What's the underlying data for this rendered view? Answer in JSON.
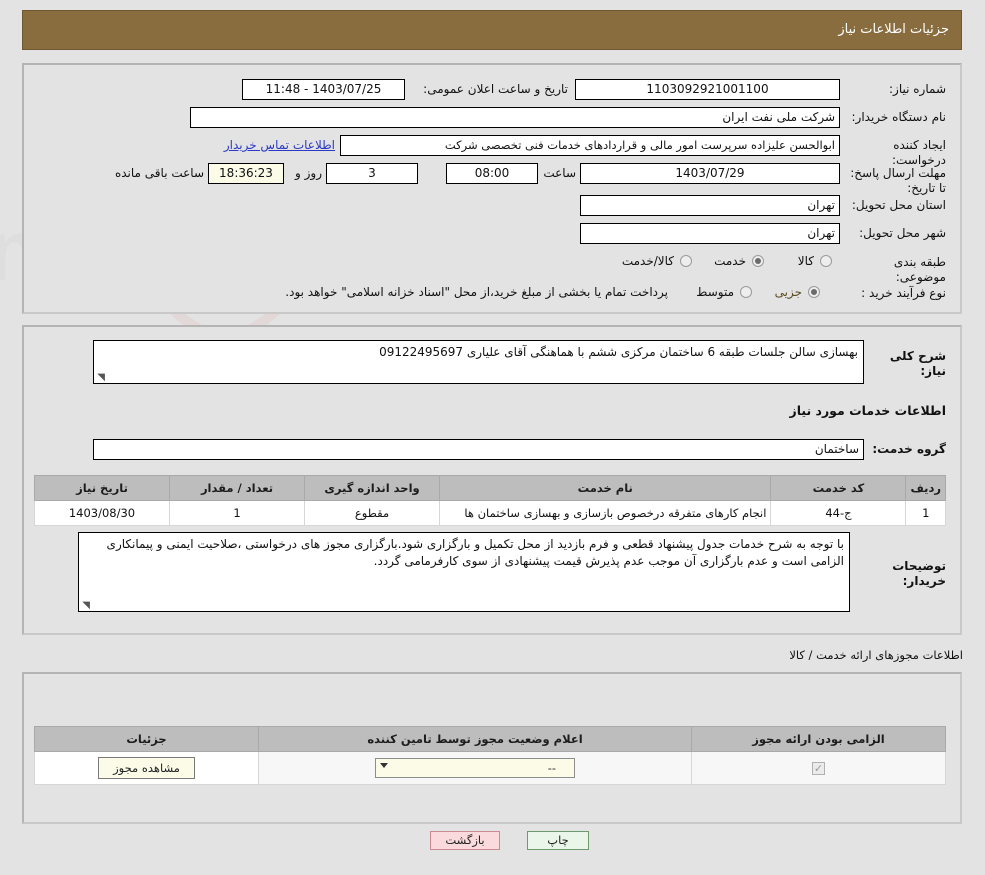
{
  "header": {
    "title": "جزئیات اطلاعات نیاز"
  },
  "form": {
    "need_number_label": "شماره نیاز:",
    "need_number_value": "1103092921001100",
    "announce_label": "تاریخ و ساعت اعلان عمومی:",
    "announce_value": "1403/07/25 - 11:48",
    "buyer_org_label": "نام دستگاه خریدار:",
    "buyer_org_value": "شرکت ملی نفت ایران",
    "requester_label": "ایجاد کننده درخواست:",
    "requester_value": "ابوالحسن علیزاده سرپرست امور مالی و قراردادهای خدمات فنی تخصصی شرکت",
    "contact_link": "اطلاعات تماس خریدار",
    "deadline_label": "مهلت ارسال پاسخ: تا تاریخ:",
    "deadline_date": "1403/07/29",
    "hour_label": "ساعت",
    "deadline_time": "08:00",
    "days_value": "3",
    "days_label": "روز و",
    "remaining_time": "18:36:23",
    "remaining_label": "ساعت باقی مانده",
    "province_label": "استان محل تحویل:",
    "province_value": "تهران",
    "city_label": "شهر محل تحویل:",
    "city_value": "تهران",
    "category_label": "طبقه بندی موضوعی:",
    "category_options": [
      "کالا",
      "خدمت",
      "کالا/خدمت"
    ],
    "category_selected": "خدمت",
    "process_label": "نوع فرآیند خرید :",
    "process_options": [
      "جزیی",
      "متوسط"
    ],
    "process_selected": "جزیی",
    "process_note": "پرداخت تمام یا بخشی از مبلغ خرید،از محل \"اسناد خزانه اسلامی\" خواهد بود."
  },
  "need": {
    "general_desc_label": "شرح کلی نیاز:",
    "general_desc_value": "بهسازی سالن جلسات طبقه 6 ساختمان مرکزی ششم با هماهنگی آقای علیاری 09122495697",
    "services_section_title": "اطلاعات خدمات مورد نیاز",
    "service_group_label": "گروه خدمت:",
    "service_group_value": "ساختمان",
    "buyer_notes_label": "توضیحات خریدار:",
    "buyer_notes_value": "با توجه به شرح خدمات جدول پیشنهاد قطعی و فرم بازدید از محل تکمیل و بارگزاری شود.بارگزاری مجوز های درخواستی ،صلاحیت ایمنی و پیمانکاری الزامی است و عدم بارگزاری آن موجب عدم پذیرش قیمت پیشنهادی  از سوی کارفرمامی گردد."
  },
  "services_table": {
    "columns": [
      "ردیف",
      "کد خدمت",
      "نام خدمت",
      "واحد اندازه گیری",
      "تعداد / مقدار",
      "تاریخ نیاز"
    ],
    "rows": [
      {
        "row": "1",
        "code": "ج-44",
        "name": "انجام کارهای متفرقه درخصوص بازسازی و بهسازی ساختمان ها",
        "unit": "مقطوع",
        "qty": "1",
        "date": "1403/08/30"
      }
    ]
  },
  "permits": {
    "section_title": "اطلاعات مجوزهای ارائه خدمت / کالا",
    "columns": [
      "الزامی بودن ارائه مجوز",
      "اعلام وضعیت مجوز توسط تامین کننده",
      "جزئیات"
    ],
    "rows": [
      {
        "required": true,
        "status_value": "--",
        "details_button": "مشاهده مجوز"
      }
    ]
  },
  "footer": {
    "print_label": "چاپ",
    "back_label": "بازگشت"
  },
  "colors": {
    "titlebar": "#8a6d3f",
    "page_bg": "#e3e3e3",
    "link": "#2b39c6",
    "table_header": "#bdbdbd",
    "print_btn": "#e9f6e9",
    "back_btn": "#fadadd",
    "highlight_field": "#fbfbe8"
  }
}
